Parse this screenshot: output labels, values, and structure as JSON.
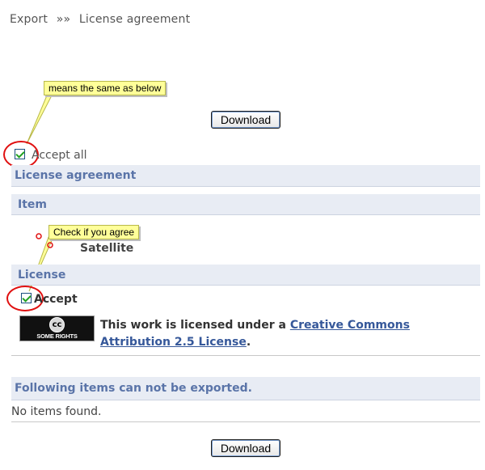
{
  "breadcrumb": {
    "root": "Export",
    "separator": "»»",
    "current": "License agreement"
  },
  "buttons": {
    "download_top": "Download",
    "download_bottom": "Download"
  },
  "accept_all": {
    "label": "Accept all",
    "checked": true
  },
  "sections": {
    "license_agreement": "License agreement",
    "item": "Item",
    "license": "License",
    "not_exported": "Following items can not be exported."
  },
  "item": {
    "name": "Satellite"
  },
  "accept": {
    "label": "Accept",
    "checked": true
  },
  "license_text": {
    "prefix": "This work is licensed under a ",
    "link": "Creative Commons Attribution 2.5 License",
    "suffix": "."
  },
  "cc_badge": {
    "symbol": "cc",
    "text": "SOME RIGHTS RESERVED"
  },
  "empty_message": "No items found.",
  "annotations": {
    "note1": "means the same as below",
    "note2": "Check if you agree"
  },
  "colors": {
    "section_bg": "#e8ecf4",
    "section_text": "#5a74a8",
    "link": "#36589a",
    "note_bg": "#ffff99",
    "circle": "#e01010",
    "check": "#21a121"
  }
}
